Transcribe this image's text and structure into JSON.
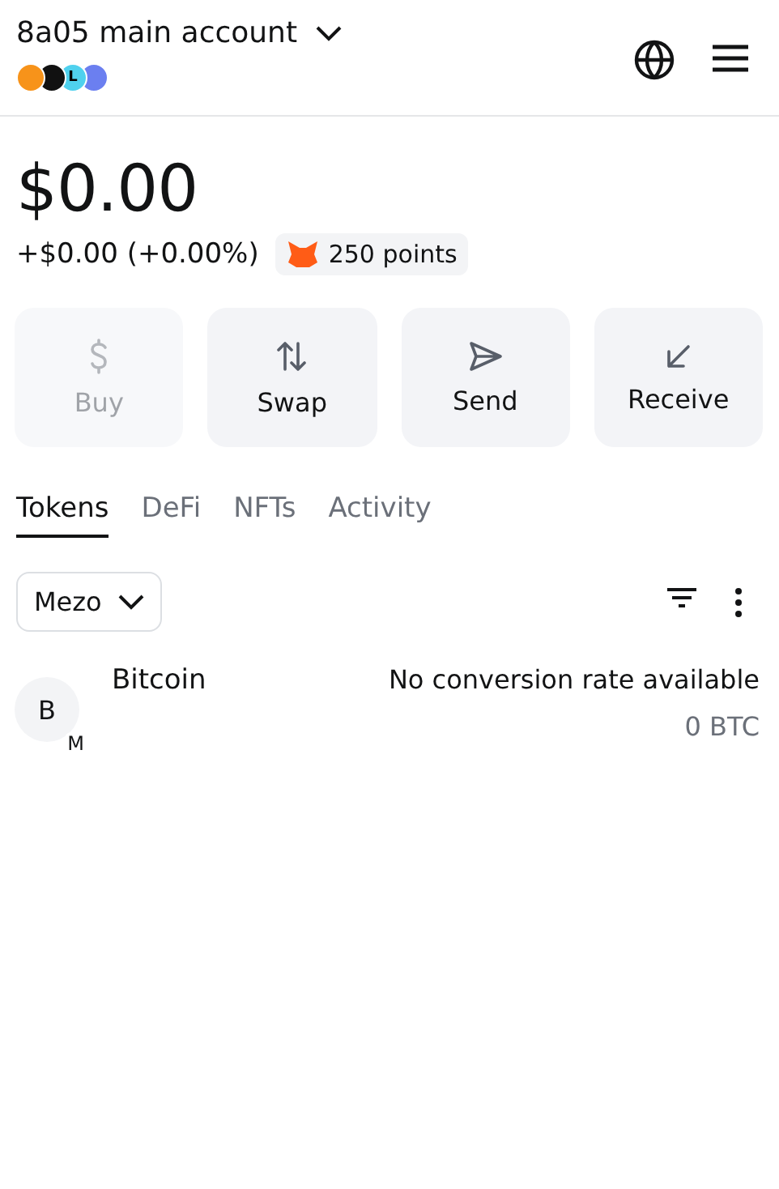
{
  "header": {
    "account": "8a05 main account",
    "networks": [
      {
        "color": "#f7931a"
      },
      {
        "color": "#111111"
      },
      {
        "color": "#4fd1ee",
        "glyph": "L"
      },
      {
        "color": "#6b7ff0"
      }
    ]
  },
  "balance": {
    "total": "$0.00",
    "change": "+$0.00 (+0.00%)",
    "points": "250 points"
  },
  "actions": [
    {
      "kind": "buy",
      "label": "Buy",
      "disabled": true
    },
    {
      "kind": "swap",
      "label": "Swap",
      "disabled": false
    },
    {
      "kind": "send",
      "label": "Send",
      "disabled": false
    },
    {
      "kind": "receive",
      "label": "Receive",
      "disabled": false
    }
  ],
  "tabs": [
    {
      "label": "Tokens",
      "selected": true
    },
    {
      "label": "DeFi",
      "selected": false
    },
    {
      "label": "NFTs",
      "selected": false
    },
    {
      "label": "Activity",
      "selected": false
    }
  ],
  "network_filter": "Mezo",
  "tokens": [
    {
      "avatar": "B",
      "badge": "M",
      "name": "Bitcoin",
      "value": "No conversion rate available",
      "amount": "0 BTC"
    }
  ]
}
